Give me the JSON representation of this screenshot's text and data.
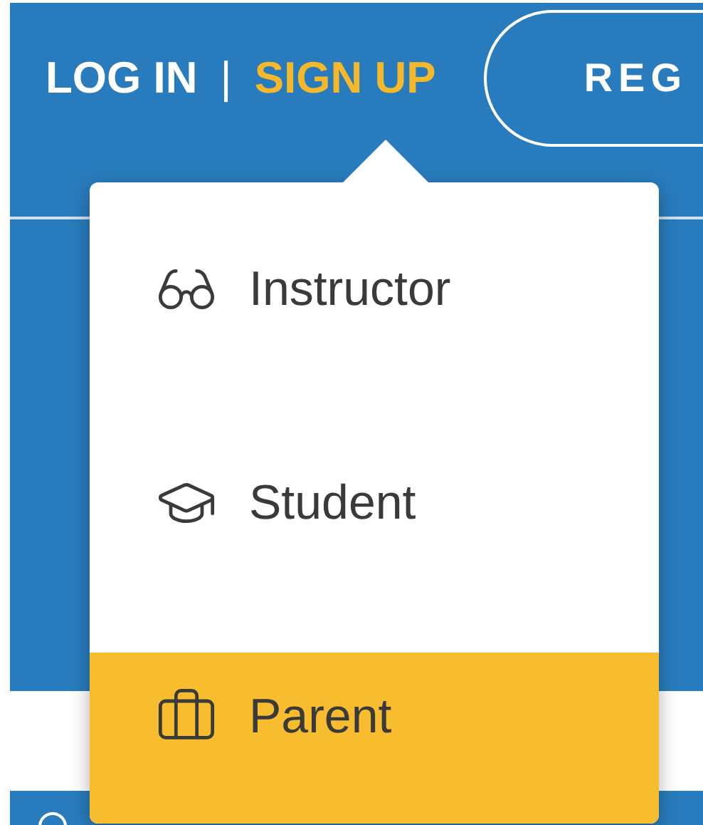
{
  "nav": {
    "login": "LOG IN",
    "separator": "|",
    "signup": "SIGN UP",
    "register_button": "REG"
  },
  "signup_menu": {
    "items": [
      {
        "label": "Instructor",
        "kind": "glasses",
        "selected": false
      },
      {
        "label": "Student",
        "kind": "cap",
        "selected": false
      },
      {
        "label": "Parent",
        "kind": "briefcase",
        "selected": true
      }
    ]
  }
}
